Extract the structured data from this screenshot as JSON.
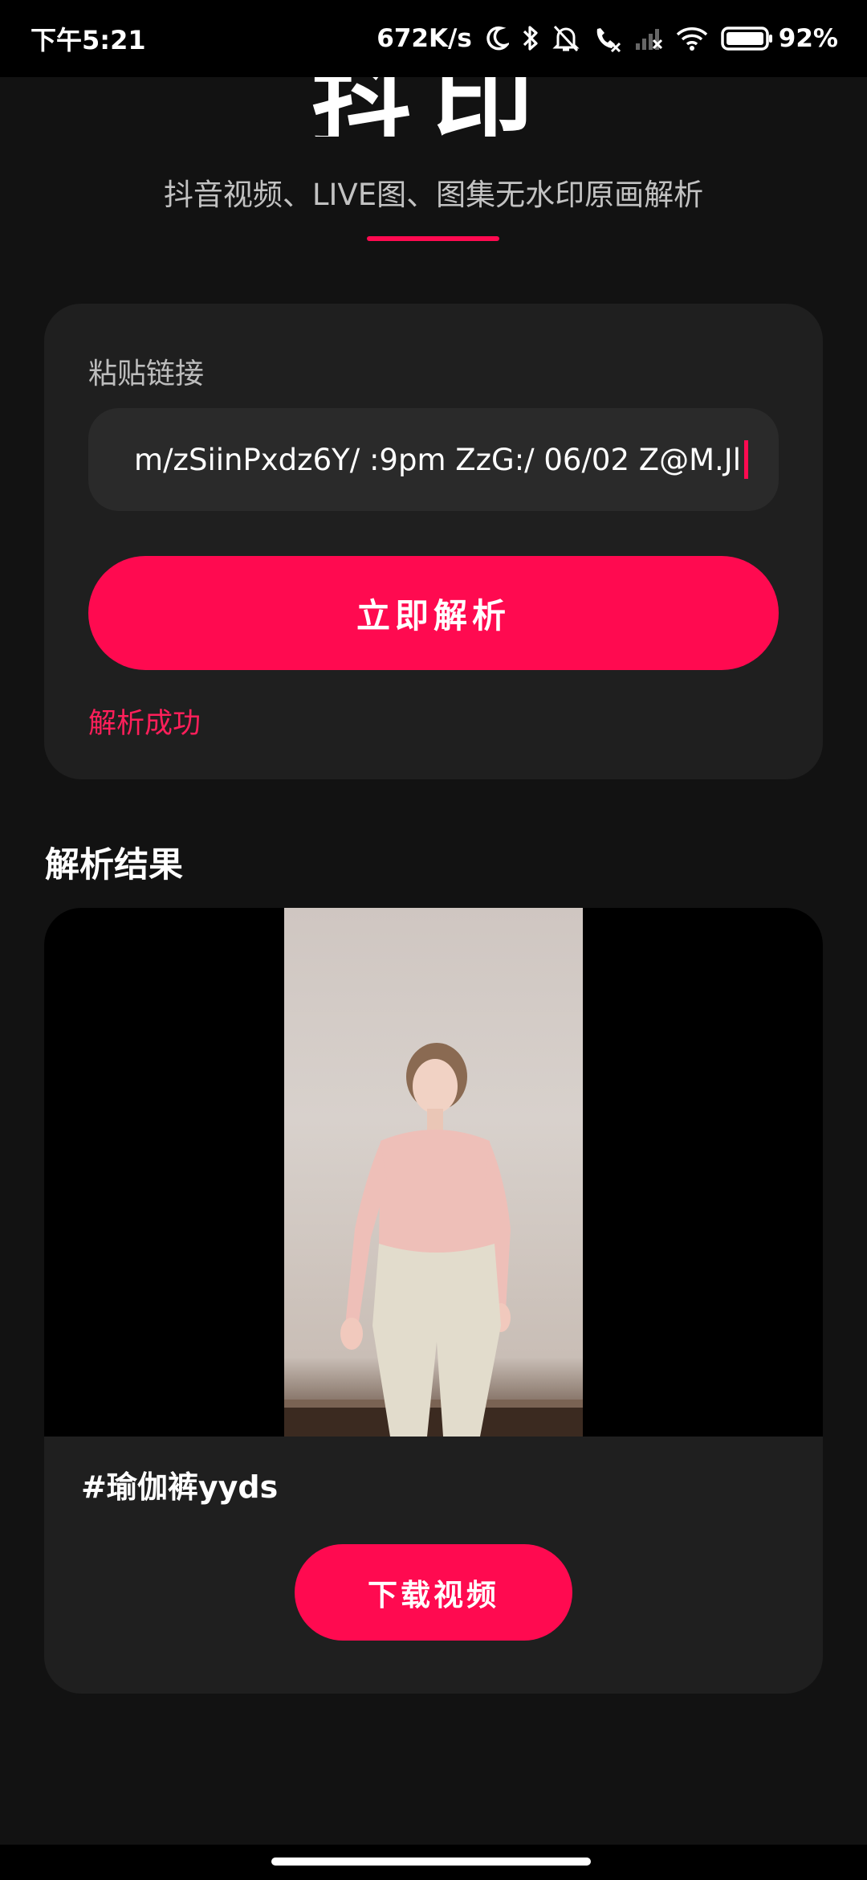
{
  "status_bar": {
    "time": "下午5:21",
    "network_speed": "672K/s",
    "battery": "92%",
    "icons": [
      "moon-icon",
      "bluetooth-icon",
      "mute-bell-icon",
      "call-forward-icon",
      "cellular-no-signal-icon",
      "wifi-icon",
      "battery-icon"
    ]
  },
  "header": {
    "app_title": "抖印",
    "subtitle": "抖音视频、LIVE图、图集无水印原画解析"
  },
  "parse_card": {
    "label": "粘贴链接",
    "input_value": "m/zSiinPxdz6Y/ :9pm ZzG:/ 06/02 Z@M.Jl",
    "parse_button": "立即解析",
    "status": "解析成功"
  },
  "results": {
    "heading": "解析结果",
    "caption": "#瑜伽裤yyds",
    "download_button": "下载视频"
  },
  "colors": {
    "accent": "#ff0a50",
    "background": "#121212",
    "card": "#1f1f1f"
  }
}
